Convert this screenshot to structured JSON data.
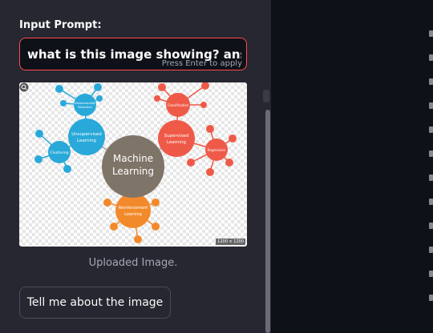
{
  "sidebar": {
    "input_label": "Input Prompt:",
    "prompt_value": "what is this image showing? answer in",
    "prompt_hint": "Press Enter to apply",
    "image_caption": "Uploaded Image.",
    "button_label": "Tell me about the image"
  },
  "image": {
    "center": "Machine Learning",
    "unsupervised": "Unsupervised Learning",
    "supervised": "Supervised Learning",
    "reinforcement": "Reinforcement Learning",
    "clustering": "Clustering",
    "dim_reduction": "Dimensionality Reduction",
    "classification": "Classification",
    "regression": "Regression",
    "size_tag": "1200 × 1200"
  },
  "colors": {
    "accent": "#ff4b4b",
    "sidebar_bg": "#262730",
    "main_bg": "#0e1117",
    "unsupervised": "#29a9d9",
    "supervised": "#ef5a48",
    "center": "#7f7468",
    "reinforcement": "#f28a2b"
  }
}
